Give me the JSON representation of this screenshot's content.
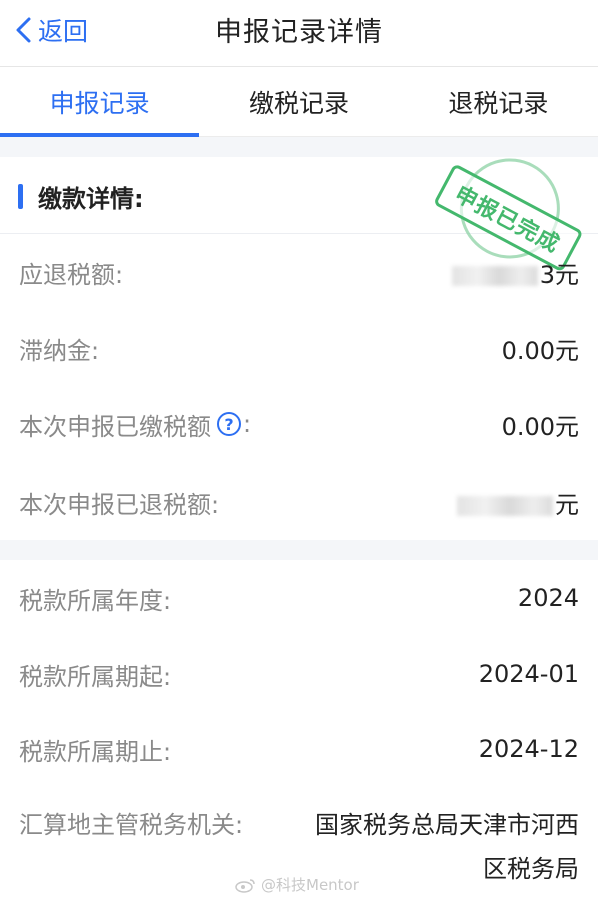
{
  "header": {
    "back_label": "返回",
    "title": "申报记录详情"
  },
  "tabs": [
    {
      "label": "申报记录",
      "active": true
    },
    {
      "label": "缴税记录",
      "active": false
    },
    {
      "label": "退税记录",
      "active": false
    }
  ],
  "section": {
    "title": "缴款详情:",
    "stamp": "申报已完成"
  },
  "payment_rows": [
    {
      "label": "应退税额:",
      "value": "3元",
      "redacted": true
    },
    {
      "label": "滞纳金:",
      "value": "0.00元"
    },
    {
      "label": "本次申报已缴税额",
      "suffix": ":",
      "value": "0.00元"
    },
    {
      "label": "本次申报已退税额:",
      "value": "元",
      "redacted": true
    }
  ],
  "info_rows": [
    {
      "label": "税款所属年度:",
      "value": "2024"
    },
    {
      "label": "税款所属期起:",
      "value": "2024-01"
    },
    {
      "label": "税款所属期止:",
      "value": "2024-12"
    },
    {
      "label": "汇算地主管税务机关:",
      "value_line1": "国家税务总局天津市河西",
      "value_line2": "区税务局"
    }
  ],
  "watermark": "@科技Mentor",
  "colors": {
    "accent": "#2d6ff2",
    "stamp": "#44b86d",
    "label": "#8a8a8a"
  }
}
